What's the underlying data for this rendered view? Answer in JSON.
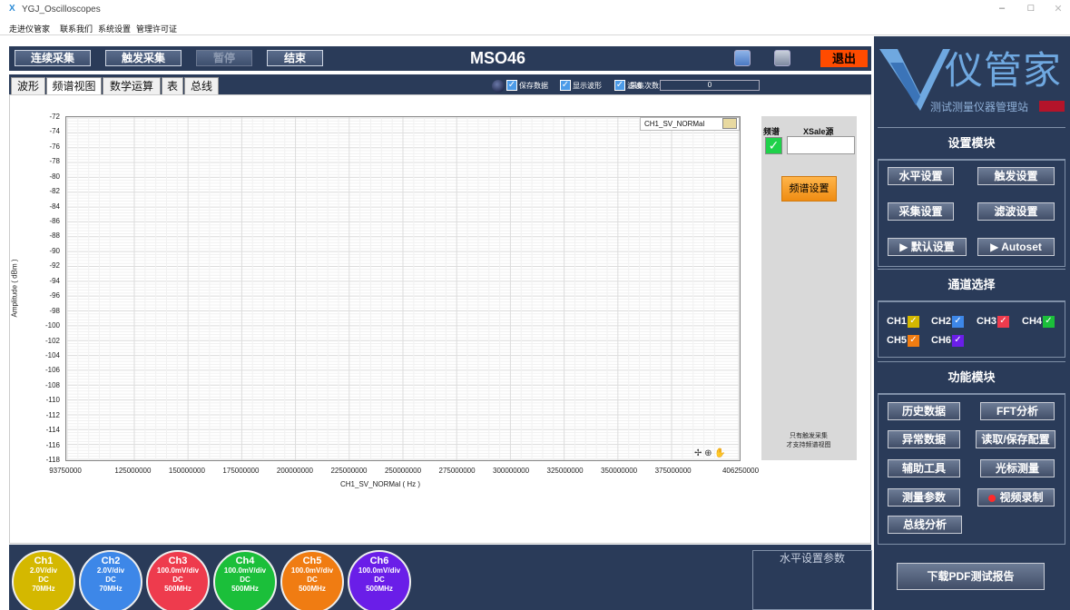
{
  "window": {
    "title": "YGJ_Oscilloscopes",
    "minimize": "–",
    "maximize": "□",
    "close": "✕"
  },
  "menu": [
    "走进仪管家",
    "联系我们",
    "系统设置",
    "管理许可证"
  ],
  "toolbar": {
    "continuous": "连续采集",
    "trigger": "触发采集",
    "pause": "暂停",
    "stop": "结束",
    "model": "MSO46",
    "quit": "退出"
  },
  "tabs": [
    "波形",
    "频谱视图",
    "数学运算",
    "表",
    "总线"
  ],
  "options": {
    "save_data": "保存数据",
    "show_wave": "显示波形",
    "filter": "滤波",
    "count_label": "采集次数:",
    "count_value": "0"
  },
  "plot": {
    "legend": "CH1_SV_NORMal",
    "ylabel": "Amplitude ( dBm )",
    "xlabel": "CH1_SV_NORMal ( Hz )",
    "yticks": [
      "-72",
      "-74",
      "-76",
      "-78",
      "-80",
      "-82",
      "-84",
      "-86",
      "-88",
      "-90",
      "-92",
      "-94",
      "-96",
      "-98",
      "-100",
      "-102",
      "-104",
      "-106",
      "-108",
      "-110",
      "-112",
      "-114",
      "-116",
      "-118"
    ],
    "xticks": [
      "93750000",
      "125000000",
      "150000000",
      "175000000",
      "200000000",
      "225000000",
      "250000000",
      "275000000",
      "300000000",
      "325000000",
      "350000000",
      "375000000",
      "406250000"
    ],
    "tools": "✢ ⊕ ✋"
  },
  "side": {
    "spectrum": "频谱",
    "xsale": "XSale源",
    "check": "✓",
    "spec_settings": "频谱设置",
    "note1": "只有触发采集",
    "note2": "才支持频谱视图"
  },
  "logo": {
    "main": "仪管家",
    "sub": "测试测量仪器管理站"
  },
  "settings": {
    "header": "设置模块",
    "horizontal": "水平设置",
    "trigger": "触发设置",
    "acquire": "采集设置",
    "filter": "滤波设置",
    "default": "▶ 默认设置",
    "autoset": "▶ Autoset"
  },
  "channels": {
    "header": "通道选择",
    "ch1": "CH1",
    "ch2": "CH2",
    "ch3": "CH3",
    "ch4": "CH4",
    "ch5": "CH5",
    "ch6": "CH6",
    "check": "✓"
  },
  "functions": {
    "header": "功能模块",
    "history": "历史数据",
    "fft": "FFT分析",
    "abnormal": "异常数据",
    "readsave": "读取/保存配置",
    "aux": "辅助工具",
    "cursor": "光标测量",
    "measure": "测量参数",
    "video": "视频录制",
    "bus": "总线分析"
  },
  "bottom": {
    "hsp_title": "水平设置参数",
    "pdf": "下载PDF测试报告",
    "ch": [
      {
        "name": "Ch1",
        "scale": "2.0V/div",
        "coupling": "DC",
        "bw": "70MHz"
      },
      {
        "name": "Ch2",
        "scale": "2.0V/div",
        "coupling": "DC",
        "bw": "70MHz"
      },
      {
        "name": "Ch3",
        "scale": "100.0mV/div",
        "coupling": "DC",
        "bw": "500MHz"
      },
      {
        "name": "Ch4",
        "scale": "100.0mV/div",
        "coupling": "DC",
        "bw": "500MHz"
      },
      {
        "name": "Ch5",
        "scale": "100.0mV/div",
        "coupling": "DC",
        "bw": "500MHz"
      },
      {
        "name": "Ch6",
        "scale": "100.0mV/div",
        "coupling": "DC",
        "bw": "500MHz"
      }
    ]
  },
  "colors": {
    "navy": "#2a3b59",
    "ch1": "#d4b800",
    "ch2": "#3d87e8",
    "ch3": "#ee3b4d",
    "ch4": "#1bbf3a",
    "ch5": "#f07c12",
    "ch6": "#6a1ee8",
    "quit": "#ff4b00",
    "accent_orange": "#ef8c12"
  }
}
